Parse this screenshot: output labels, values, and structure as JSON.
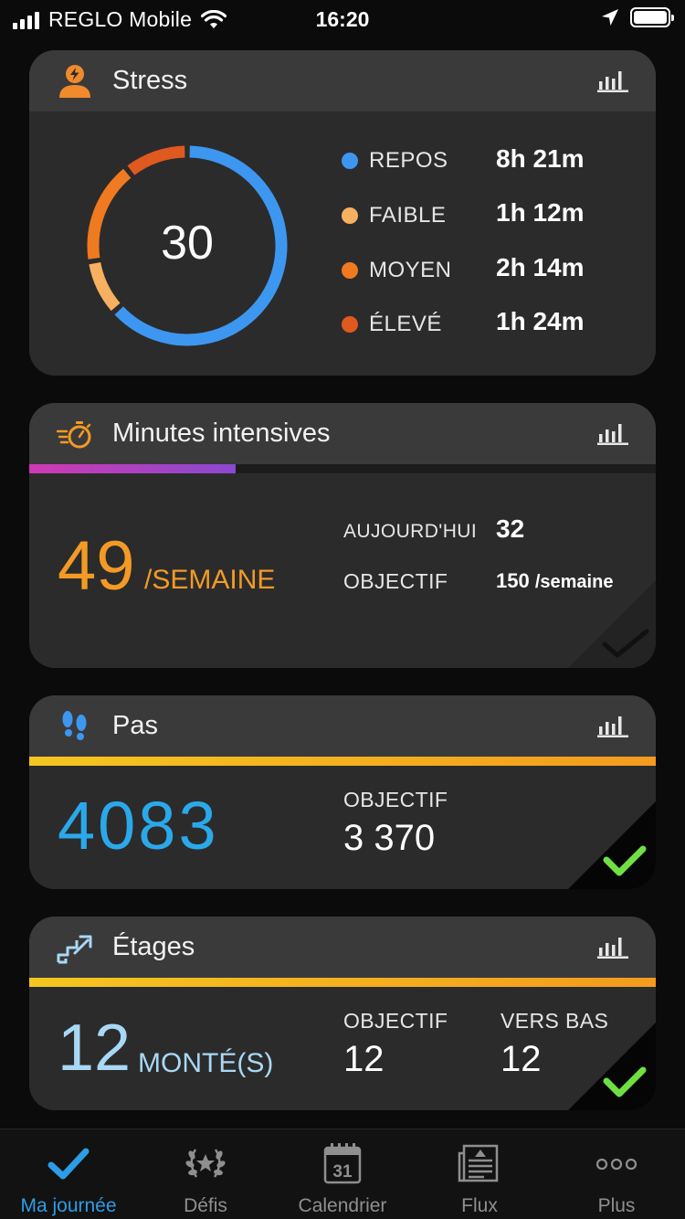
{
  "status_bar": {
    "carrier": "REGLO Mobile",
    "time": "16:20"
  },
  "colors": {
    "accent_blue": "#3d97f0",
    "stress_rest": "#3d97f0",
    "stress_low": "#f6b060",
    "stress_medium": "#ef7a1f",
    "stress_high": "#e0591e",
    "intensity_orange": "#f39a24",
    "steps_blue": "#2aa9ea",
    "floors_blue": "#a9d8f5",
    "check_green": "#6fe044"
  },
  "stress": {
    "title": "Stress",
    "value": "30",
    "breakdown": [
      {
        "label": "REPOS",
        "value": "8h 21m",
        "minutes": 501,
        "color": "#3d97f0"
      },
      {
        "label": "FAIBLE",
        "value": "1h 12m",
        "minutes": 72,
        "color": "#f6b060"
      },
      {
        "label": "MOYEN",
        "value": "2h 14m",
        "minutes": 134,
        "color": "#ef7a1f"
      },
      {
        "label": "ÉLEVÉ",
        "value": "1h 24m",
        "minutes": 84,
        "color": "#e0591e"
      }
    ]
  },
  "intensity": {
    "title": "Minutes intensives",
    "value": "49",
    "unit": "/SEMAINE",
    "progress": 0.33,
    "today_label": "AUJOURD'HUI",
    "today_value": "32",
    "goal_label": "OBJECTIF",
    "goal_value": "150",
    "goal_unit": "/semaine"
  },
  "steps": {
    "title": "Pas",
    "value": "4083",
    "goal_label": "OBJECTIF",
    "goal_value": "3 370",
    "progress": 1.0
  },
  "floors": {
    "title": "Étages",
    "value": "12",
    "unit": "MONTÉ(S)",
    "goal_label": "OBJECTIF",
    "goal_value": "12",
    "down_label": "VERS BAS",
    "down_value": "12",
    "progress": 1.0
  },
  "tabs": [
    {
      "label": "Ma journée",
      "icon": "check-icon",
      "active": true
    },
    {
      "label": "Défis",
      "icon": "laurel-icon",
      "active": false
    },
    {
      "label": "Calendrier",
      "icon": "calendar-icon",
      "active": false,
      "badge": "31"
    },
    {
      "label": "Flux",
      "icon": "newsfeed-icon",
      "active": false
    },
    {
      "label": "Plus",
      "icon": "more-icon",
      "active": false
    }
  ]
}
